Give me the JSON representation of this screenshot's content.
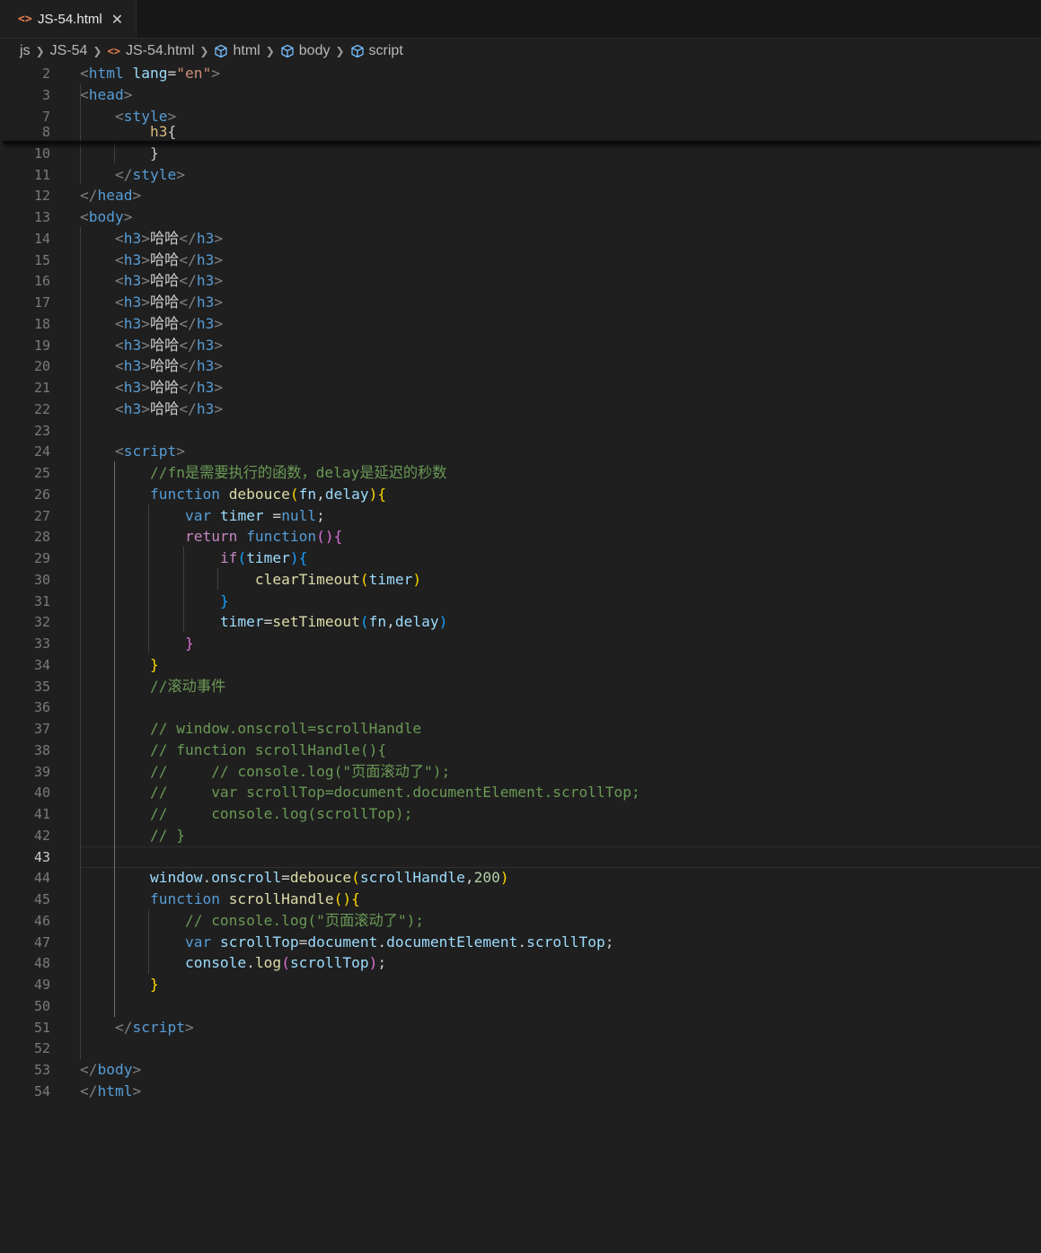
{
  "tab": {
    "icon": "<>",
    "label": "JS-54.html",
    "close": "✕"
  },
  "breadcrumb": [
    {
      "label": "js",
      "icon": ""
    },
    {
      "label": "JS-54",
      "icon": ""
    },
    {
      "label": "JS-54.html",
      "icon": "html-icon"
    },
    {
      "label": "html",
      "icon": "element-cube-icon"
    },
    {
      "label": "body",
      "icon": "element-cube-icon"
    },
    {
      "label": "script",
      "icon": "element-cube-icon"
    }
  ],
  "active_line": "43",
  "lines": [
    {
      "n": "2",
      "tokens": [
        [
          "t-br",
          "<"
        ],
        [
          "t-tag",
          "html"
        ],
        [
          "t-txt",
          " "
        ],
        [
          "t-attr",
          "lang"
        ],
        [
          "t-txt",
          "="
        ],
        [
          "t-str",
          "\"en\""
        ],
        [
          "t-br",
          ">"
        ]
      ]
    },
    {
      "n": "3",
      "tokens": [
        [
          "t-br",
          "<"
        ],
        [
          "t-tag",
          "head"
        ],
        [
          "t-br",
          ">"
        ]
      ]
    },
    {
      "n": "7",
      "tokens": [
        [
          "t-txt",
          "    "
        ],
        [
          "t-br",
          "<"
        ],
        [
          "t-tag",
          "style"
        ],
        [
          "t-br",
          ">"
        ]
      ]
    },
    {
      "n": "8",
      "tokens": [
        [
          "t-txt",
          "        "
        ],
        [
          "t-css",
          "h3"
        ],
        [
          "t-txt",
          "{"
        ]
      ]
    },
    {
      "n": "10",
      "tokens": [
        [
          "t-txt",
          "        }"
        ]
      ]
    },
    {
      "n": "11",
      "tokens": [
        [
          "t-txt",
          "    "
        ],
        [
          "t-br",
          "</"
        ],
        [
          "t-tag",
          "style"
        ],
        [
          "t-br",
          ">"
        ]
      ]
    },
    {
      "n": "12",
      "tokens": [
        [
          "t-br",
          "</"
        ],
        [
          "t-tag",
          "head"
        ],
        [
          "t-br",
          ">"
        ]
      ]
    },
    {
      "n": "13",
      "tokens": [
        [
          "t-br",
          "<"
        ],
        [
          "t-tag",
          "body"
        ],
        [
          "t-br",
          ">"
        ]
      ]
    },
    {
      "n": "14",
      "tokens": [
        [
          "t-txt",
          "    "
        ],
        [
          "t-br",
          "<"
        ],
        [
          "t-tag",
          "h3"
        ],
        [
          "t-br",
          ">"
        ],
        [
          "t-txt",
          "哈哈"
        ],
        [
          "t-br",
          "</"
        ],
        [
          "t-tag",
          "h3"
        ],
        [
          "t-br",
          ">"
        ]
      ]
    },
    {
      "n": "15",
      "tokens": [
        [
          "t-txt",
          "    "
        ],
        [
          "t-br",
          "<"
        ],
        [
          "t-tag",
          "h3"
        ],
        [
          "t-br",
          ">"
        ],
        [
          "t-txt",
          "哈哈"
        ],
        [
          "t-br",
          "</"
        ],
        [
          "t-tag",
          "h3"
        ],
        [
          "t-br",
          ">"
        ]
      ]
    },
    {
      "n": "16",
      "tokens": [
        [
          "t-txt",
          "    "
        ],
        [
          "t-br",
          "<"
        ],
        [
          "t-tag",
          "h3"
        ],
        [
          "t-br",
          ">"
        ],
        [
          "t-txt",
          "哈哈"
        ],
        [
          "t-br",
          "</"
        ],
        [
          "t-tag",
          "h3"
        ],
        [
          "t-br",
          ">"
        ]
      ]
    },
    {
      "n": "17",
      "tokens": [
        [
          "t-txt",
          "    "
        ],
        [
          "t-br",
          "<"
        ],
        [
          "t-tag",
          "h3"
        ],
        [
          "t-br",
          ">"
        ],
        [
          "t-txt",
          "哈哈"
        ],
        [
          "t-br",
          "</"
        ],
        [
          "t-tag",
          "h3"
        ],
        [
          "t-br",
          ">"
        ]
      ]
    },
    {
      "n": "18",
      "tokens": [
        [
          "t-txt",
          "    "
        ],
        [
          "t-br",
          "<"
        ],
        [
          "t-tag",
          "h3"
        ],
        [
          "t-br",
          ">"
        ],
        [
          "t-txt",
          "哈哈"
        ],
        [
          "t-br",
          "</"
        ],
        [
          "t-tag",
          "h3"
        ],
        [
          "t-br",
          ">"
        ]
      ]
    },
    {
      "n": "19",
      "tokens": [
        [
          "t-txt",
          "    "
        ],
        [
          "t-br",
          "<"
        ],
        [
          "t-tag",
          "h3"
        ],
        [
          "t-br",
          ">"
        ],
        [
          "t-txt",
          "哈哈"
        ],
        [
          "t-br",
          "</"
        ],
        [
          "t-tag",
          "h3"
        ],
        [
          "t-br",
          ">"
        ]
      ]
    },
    {
      "n": "20",
      "tokens": [
        [
          "t-txt",
          "    "
        ],
        [
          "t-br",
          "<"
        ],
        [
          "t-tag",
          "h3"
        ],
        [
          "t-br",
          ">"
        ],
        [
          "t-txt",
          "哈哈"
        ],
        [
          "t-br",
          "</"
        ],
        [
          "t-tag",
          "h3"
        ],
        [
          "t-br",
          ">"
        ]
      ]
    },
    {
      "n": "21",
      "tokens": [
        [
          "t-txt",
          "    "
        ],
        [
          "t-br",
          "<"
        ],
        [
          "t-tag",
          "h3"
        ],
        [
          "t-br",
          ">"
        ],
        [
          "t-txt",
          "哈哈"
        ],
        [
          "t-br",
          "</"
        ],
        [
          "t-tag",
          "h3"
        ],
        [
          "t-br",
          ">"
        ]
      ]
    },
    {
      "n": "22",
      "tokens": [
        [
          "t-txt",
          "    "
        ],
        [
          "t-br",
          "<"
        ],
        [
          "t-tag",
          "h3"
        ],
        [
          "t-br",
          ">"
        ],
        [
          "t-txt",
          "哈哈"
        ],
        [
          "t-br",
          "</"
        ],
        [
          "t-tag",
          "h3"
        ],
        [
          "t-br",
          ">"
        ]
      ]
    },
    {
      "n": "23",
      "tokens": []
    },
    {
      "n": "24",
      "tokens": [
        [
          "t-txt",
          "    "
        ],
        [
          "t-br",
          "<"
        ],
        [
          "t-tag",
          "script"
        ],
        [
          "t-br",
          ">"
        ]
      ]
    },
    {
      "n": "25",
      "tokens": [
        [
          "t-txt",
          "        "
        ],
        [
          "t-com",
          "//fn是需要执行的函数，delay是延迟的秒数"
        ]
      ]
    },
    {
      "n": "26",
      "tokens": [
        [
          "t-txt",
          "        "
        ],
        [
          "t-kw",
          "function"
        ],
        [
          "t-txt",
          " "
        ],
        [
          "t-fn",
          "debouce"
        ],
        [
          "t-p1",
          "("
        ],
        [
          "t-var",
          "fn"
        ],
        [
          "t-txt",
          ","
        ],
        [
          "t-var",
          "delay"
        ],
        [
          "t-p1",
          ")"
        ],
        [
          "t-p1",
          "{"
        ]
      ]
    },
    {
      "n": "27",
      "tokens": [
        [
          "t-txt",
          "            "
        ],
        [
          "t-kw",
          "var"
        ],
        [
          "t-txt",
          " "
        ],
        [
          "t-var",
          "timer"
        ],
        [
          "t-txt",
          " ="
        ],
        [
          "t-kw",
          "null"
        ],
        [
          "t-txt",
          ";"
        ]
      ]
    },
    {
      "n": "28",
      "tokens": [
        [
          "t-txt",
          "            "
        ],
        [
          "t-ctl",
          "return"
        ],
        [
          "t-txt",
          " "
        ],
        [
          "t-kw",
          "function"
        ],
        [
          "t-p2",
          "()"
        ],
        [
          "t-p2",
          "{"
        ]
      ]
    },
    {
      "n": "29",
      "tokens": [
        [
          "t-txt",
          "                "
        ],
        [
          "t-ctl",
          "if"
        ],
        [
          "t-p3",
          "("
        ],
        [
          "t-var",
          "timer"
        ],
        [
          "t-p3",
          ")"
        ],
        [
          "t-p3",
          "{"
        ]
      ]
    },
    {
      "n": "30",
      "tokens": [
        [
          "t-txt",
          "                    "
        ],
        [
          "t-fn",
          "clearTimeout"
        ],
        [
          "t-p1",
          "("
        ],
        [
          "t-var",
          "timer"
        ],
        [
          "t-p1",
          ")"
        ]
      ]
    },
    {
      "n": "31",
      "tokens": [
        [
          "t-txt",
          "                "
        ],
        [
          "t-p3",
          "}"
        ]
      ]
    },
    {
      "n": "32",
      "tokens": [
        [
          "t-txt",
          "                "
        ],
        [
          "t-var",
          "timer"
        ],
        [
          "t-txt",
          "="
        ],
        [
          "t-fn",
          "setTimeout"
        ],
        [
          "t-p3",
          "("
        ],
        [
          "t-var",
          "fn"
        ],
        [
          "t-txt",
          ","
        ],
        [
          "t-var",
          "delay"
        ],
        [
          "t-p3",
          ")"
        ]
      ]
    },
    {
      "n": "33",
      "tokens": [
        [
          "t-txt",
          "            "
        ],
        [
          "t-p2",
          "}"
        ]
      ]
    },
    {
      "n": "34",
      "tokens": [
        [
          "t-txt",
          "        "
        ],
        [
          "t-p1",
          "}"
        ]
      ]
    },
    {
      "n": "35",
      "tokens": [
        [
          "t-txt",
          "        "
        ],
        [
          "t-com",
          "//滚动事件"
        ]
      ]
    },
    {
      "n": "36",
      "tokens": []
    },
    {
      "n": "37",
      "tokens": [
        [
          "t-txt",
          "        "
        ],
        [
          "t-com",
          "// window.onscroll=scrollHandle"
        ]
      ]
    },
    {
      "n": "38",
      "tokens": [
        [
          "t-txt",
          "        "
        ],
        [
          "t-com",
          "// function scrollHandle(){"
        ]
      ]
    },
    {
      "n": "39",
      "tokens": [
        [
          "t-txt",
          "        "
        ],
        [
          "t-com",
          "//     // console.log(\"页面滚动了\");"
        ]
      ]
    },
    {
      "n": "40",
      "tokens": [
        [
          "t-txt",
          "        "
        ],
        [
          "t-com",
          "//     var scrollTop=document.documentElement.scrollTop;"
        ]
      ]
    },
    {
      "n": "41",
      "tokens": [
        [
          "t-txt",
          "        "
        ],
        [
          "t-com",
          "//     console.log(scrollTop);"
        ]
      ]
    },
    {
      "n": "42",
      "tokens": [
        [
          "t-txt",
          "        "
        ],
        [
          "t-com",
          "// }"
        ]
      ]
    },
    {
      "n": "43",
      "tokens": []
    },
    {
      "n": "44",
      "tokens": [
        [
          "t-txt",
          "        "
        ],
        [
          "t-var",
          "window"
        ],
        [
          "t-txt",
          "."
        ],
        [
          "t-var",
          "onscroll"
        ],
        [
          "t-txt",
          "="
        ],
        [
          "t-fn",
          "debouce"
        ],
        [
          "t-p1",
          "("
        ],
        [
          "t-var",
          "scrollHandle"
        ],
        [
          "t-txt",
          ","
        ],
        [
          "t-num",
          "200"
        ],
        [
          "t-p1",
          ")"
        ]
      ]
    },
    {
      "n": "45",
      "tokens": [
        [
          "t-txt",
          "        "
        ],
        [
          "t-kw",
          "function"
        ],
        [
          "t-txt",
          " "
        ],
        [
          "t-fn",
          "scrollHandle"
        ],
        [
          "t-p1",
          "()"
        ],
        [
          "t-p1",
          "{"
        ]
      ]
    },
    {
      "n": "46",
      "tokens": [
        [
          "t-txt",
          "            "
        ],
        [
          "t-com",
          "// console.log(\"页面滚动了\");"
        ]
      ]
    },
    {
      "n": "47",
      "tokens": [
        [
          "t-txt",
          "            "
        ],
        [
          "t-kw",
          "var"
        ],
        [
          "t-txt",
          " "
        ],
        [
          "t-var",
          "scrollTop"
        ],
        [
          "t-txt",
          "="
        ],
        [
          "t-var",
          "document"
        ],
        [
          "t-txt",
          "."
        ],
        [
          "t-var",
          "documentElement"
        ],
        [
          "t-txt",
          "."
        ],
        [
          "t-var",
          "scrollTop"
        ],
        [
          "t-txt",
          ";"
        ]
      ]
    },
    {
      "n": "48",
      "tokens": [
        [
          "t-txt",
          "            "
        ],
        [
          "t-var",
          "console"
        ],
        [
          "t-txt",
          "."
        ],
        [
          "t-fn",
          "log"
        ],
        [
          "t-p2",
          "("
        ],
        [
          "t-var",
          "scrollTop"
        ],
        [
          "t-p2",
          ")"
        ],
        [
          "t-txt",
          ";"
        ]
      ]
    },
    {
      "n": "49",
      "tokens": [
        [
          "t-txt",
          "        "
        ],
        [
          "t-p1",
          "}"
        ]
      ]
    },
    {
      "n": "50",
      "tokens": []
    },
    {
      "n": "51",
      "tokens": [
        [
          "t-txt",
          "    "
        ],
        [
          "t-br",
          "</"
        ],
        [
          "t-tag",
          "script"
        ],
        [
          "t-br",
          ">"
        ]
      ]
    },
    {
      "n": "52",
      "tokens": []
    },
    {
      "n": "53",
      "tokens": [
        [
          "t-br",
          "</"
        ],
        [
          "t-tag",
          "body"
        ],
        [
          "t-br",
          ">"
        ]
      ]
    },
    {
      "n": "54",
      "tokens": [
        [
          "t-br",
          "</"
        ],
        [
          "t-tag",
          "html"
        ],
        [
          "t-br",
          ">"
        ]
      ]
    }
  ]
}
